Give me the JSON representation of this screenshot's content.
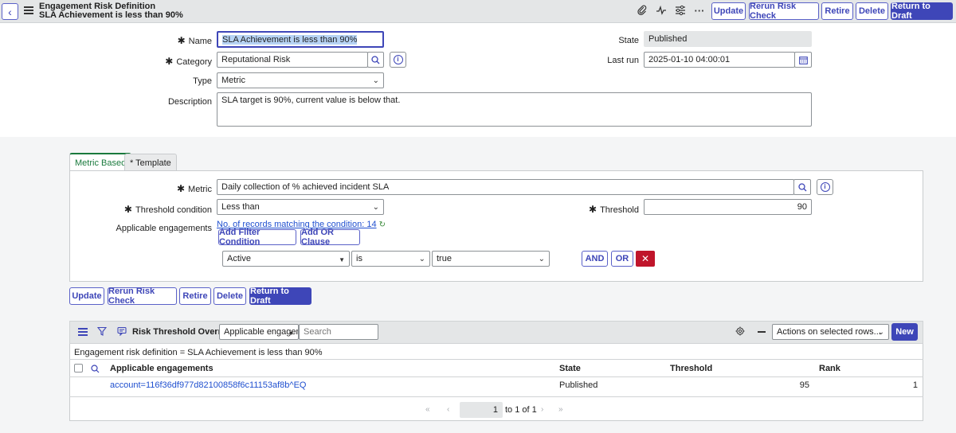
{
  "header": {
    "title_line1": "Engagement Risk Definition",
    "title_line2": "SLA Achievement is less than 90%",
    "icons": [
      "back-icon",
      "menu-icon",
      "paperclip-icon",
      "activity-icon",
      "settings-sliders-icon",
      "more-icon"
    ],
    "buttons": {
      "update": "Update",
      "rerun": "Rerun Risk Check",
      "retire": "Retire",
      "delete": "Delete",
      "return": "Return to Draft"
    }
  },
  "form": {
    "name_label": "Name",
    "name_value": "SLA Achievement is less than 90%",
    "category_label": "Category",
    "category_value": "Reputational Risk",
    "type_label": "Type",
    "type_value": "Metric",
    "description_label": "Description",
    "description_value": "SLA target is 90%, current value is below that.",
    "state_label": "State",
    "state_value": "Published",
    "lastrun_label": "Last run",
    "lastrun_value": "2025-01-10 04:00:01"
  },
  "tabs": {
    "metric_based": "Metric Based",
    "template": "* Template"
  },
  "metric_section": {
    "metric_label": "Metric",
    "metric_value": "Daily collection of % achieved incident SLA",
    "threshold_condition_label": "Threshold condition",
    "threshold_condition_value": "Less than",
    "threshold_label": "Threshold",
    "threshold_value": "90",
    "applicable_label": "Applicable engagements",
    "records_link": "No. of records matching the condition: 14",
    "add_filter": "Add Filter Condition",
    "add_or": "Add OR Clause",
    "condition": {
      "field": "Active",
      "operator": "is",
      "value": "true"
    },
    "and_label": "AND",
    "or_label": "OR"
  },
  "bottom_buttons": {
    "update": "Update",
    "rerun": "Rerun Risk Check",
    "retire": "Retire",
    "delete": "Delete",
    "return": "Return to Draft"
  },
  "related_list": {
    "title": "Risk Threshold Overrides",
    "filter_select": "Applicable engagem",
    "search_placeholder": "Search",
    "actions_select": "Actions on selected rows...",
    "new_label": "New",
    "breadcrumb": "Engagement risk definition = SLA Achievement is less than 90%",
    "columns": [
      "Applicable engagements",
      "State",
      "Threshold",
      "Rank"
    ],
    "rows": [
      {
        "engagement": "account=116f36df977d82100858f6c11153af8b^EQ",
        "state": "Published",
        "threshold": "95",
        "rank": "1"
      }
    ],
    "pagination": {
      "current": "1",
      "range_text": "to 1 of 1"
    }
  }
}
